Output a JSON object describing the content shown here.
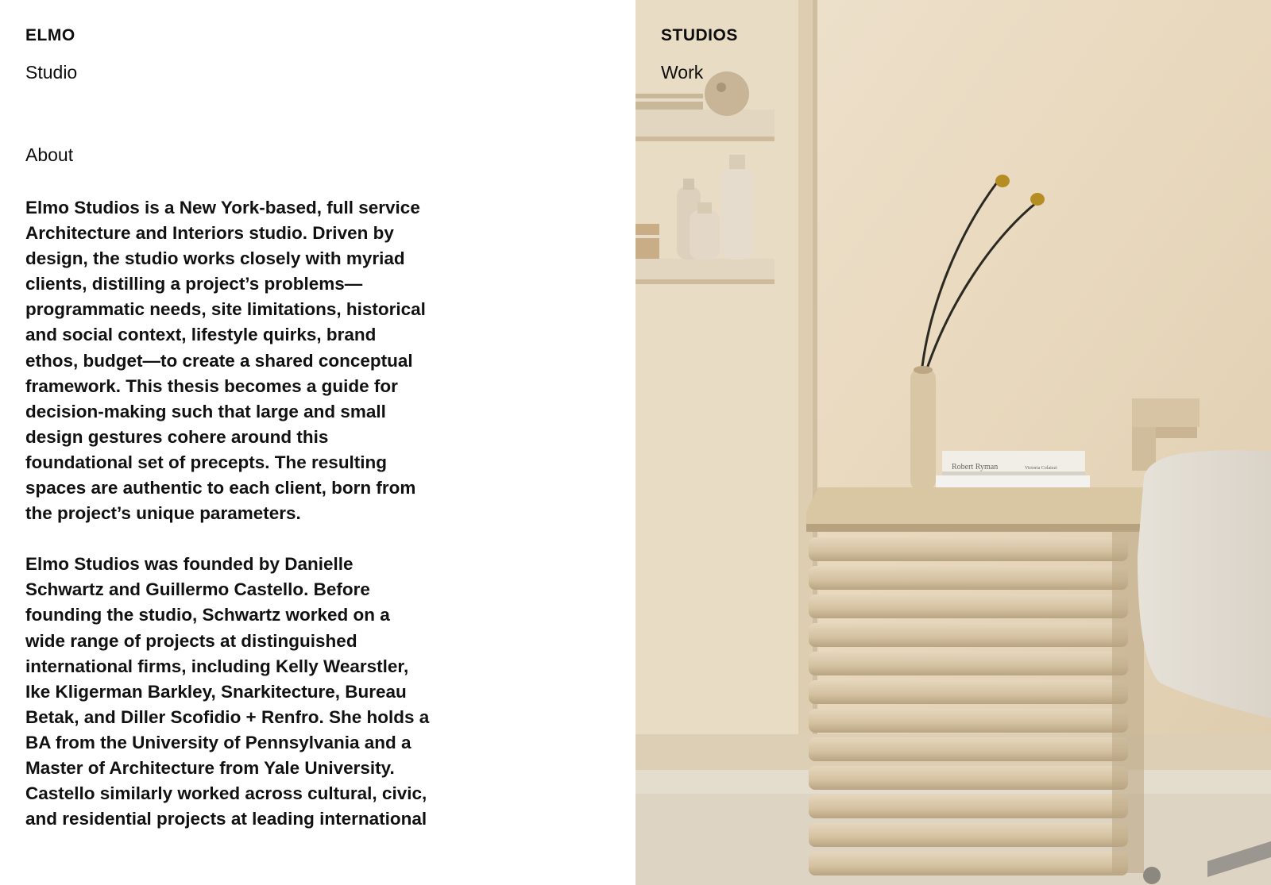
{
  "header": {
    "logo_left": "ELMO",
    "logo_right": "STUDIOS",
    "nav_studio": "Studio",
    "nav_work": "Work"
  },
  "about": {
    "heading": "About",
    "paragraphs": [
      "Elmo Studios is a New York-based, full service Architecture and Interiors studio. Driven by design, the studio works closely with myriad clients, distilling a project’s problems—programmatic needs, site limitations, historical and social context, lifestyle quirks, brand ethos, budget—to create a shared conceptual framework. This thesis becomes a guide for decision-making such that large and small design gestures cohere around this foundational set of precepts. The resulting spaces are authentic to each client, born from the project’s unique parameters.",
      "Elmo Studios was founded by Danielle Schwartz and Guillermo Castello. Before founding the studio, Schwartz worked on a wide range of projects at distinguished international firms, including Kelly Wearstler, Ike Kligerman Barkley, Snarkitecture, Bureau Betak, and Diller Scofidio + Renfro. She holds a BA from the University of Pennsylvania and a Master of Architecture from Yale University. Castello similarly worked across cultural, civic, and residential projects at leading international"
    ]
  },
  "photo": {
    "book_title": "Robert Ryman",
    "book_publisher": "Victoria Colaizzi"
  },
  "colors": {
    "text": "#111111",
    "wall": "#e8dac2",
    "wood": "#d8c6a6"
  }
}
